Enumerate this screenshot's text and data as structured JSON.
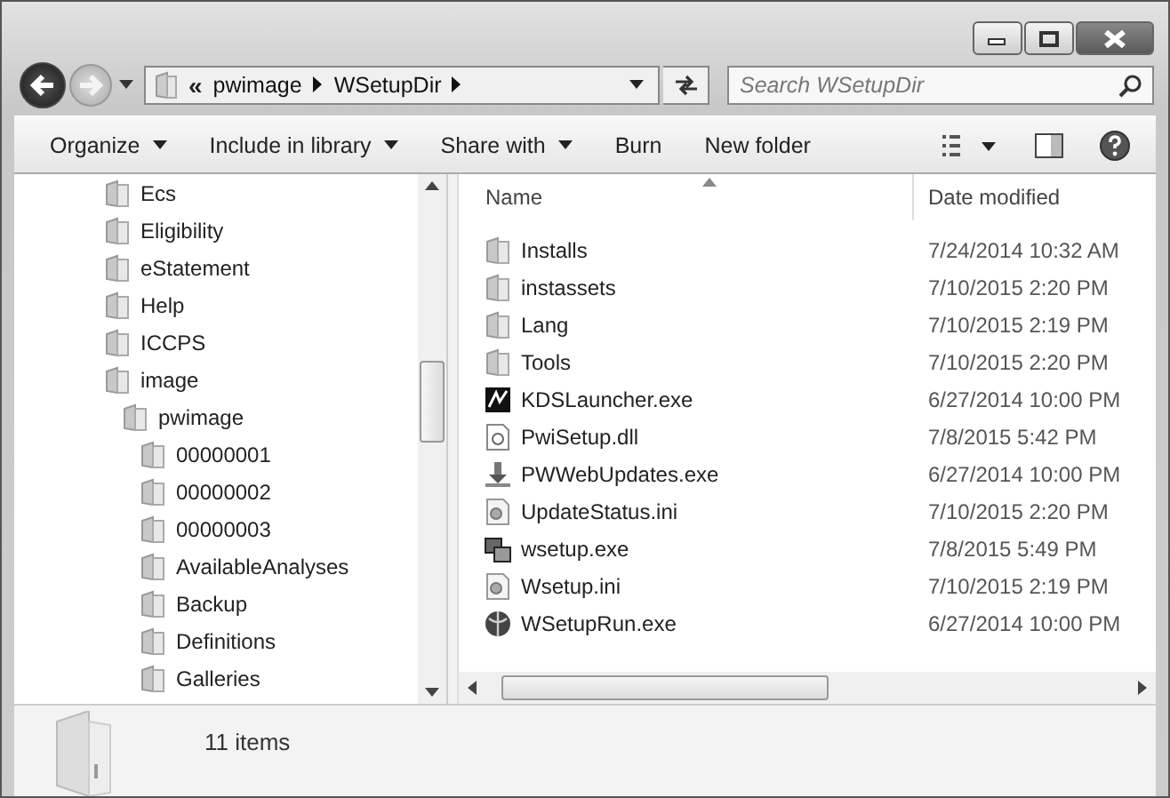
{
  "address": {
    "overflow": "«",
    "crumbs": [
      "pwimage",
      "WSetupDir"
    ]
  },
  "search": {
    "placeholder": "Search WSetupDir"
  },
  "toolbar": {
    "items": [
      {
        "label": "Organize",
        "dropdown": true
      },
      {
        "label": "Include in library",
        "dropdown": true
      },
      {
        "label": "Share with",
        "dropdown": true
      },
      {
        "label": "Burn",
        "dropdown": false
      },
      {
        "label": "New folder",
        "dropdown": false
      }
    ]
  },
  "tree": [
    {
      "label": "Ecs"
    },
    {
      "label": "Eligibility"
    },
    {
      "label": "eStatement"
    },
    {
      "label": "Help"
    },
    {
      "label": "ICCPS"
    },
    {
      "label": "image",
      "children": [
        {
          "label": "pwimage",
          "children": [
            {
              "label": "00000001"
            },
            {
              "label": "00000002"
            },
            {
              "label": "00000003"
            },
            {
              "label": "AvailableAnalyses"
            },
            {
              "label": "Backup"
            },
            {
              "label": "Definitions"
            },
            {
              "label": "Galleries"
            }
          ]
        }
      ]
    }
  ],
  "table": {
    "columns": [
      "Name",
      "Date modified"
    ],
    "rows": [
      {
        "kind": "folder",
        "name": "Installs",
        "date": "7/24/2014 10:32 AM"
      },
      {
        "kind": "folder",
        "name": "instassets",
        "date": "7/10/2015 2:20 PM"
      },
      {
        "kind": "folder",
        "name": "Lang",
        "date": "7/10/2015 2:19 PM"
      },
      {
        "kind": "folder",
        "name": "Tools",
        "date": "7/10/2015 2:20 PM"
      },
      {
        "kind": "app",
        "name": "KDSLauncher.exe",
        "date": "6/27/2014 10:00 PM"
      },
      {
        "kind": "dll",
        "name": "PwiSetup.dll",
        "date": "7/8/2015 5:42 PM"
      },
      {
        "kind": "installer",
        "name": "PWWebUpdates.exe",
        "date": "6/27/2014 10:00 PM"
      },
      {
        "kind": "ini",
        "name": "UpdateStatus.ini",
        "date": "7/10/2015 2:20 PM"
      },
      {
        "kind": "setup",
        "name": "wsetup.exe",
        "date": "7/8/2015 5:49 PM"
      },
      {
        "kind": "ini",
        "name": "Wsetup.ini",
        "date": "7/10/2015 2:19 PM"
      },
      {
        "kind": "globe",
        "name": "WSetupRun.exe",
        "date": "6/27/2014 10:00 PM"
      }
    ]
  },
  "status_bar": {
    "count": "11 items"
  }
}
